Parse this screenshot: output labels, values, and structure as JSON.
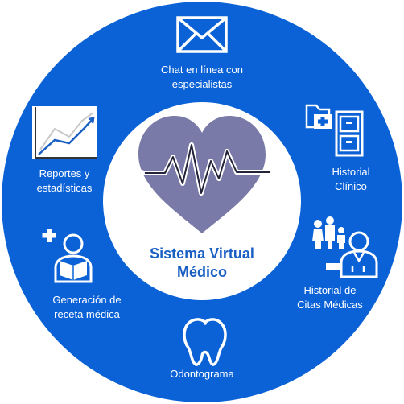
{
  "colors": {
    "ring": "#0b62d6",
    "center_bg": "#ffffff",
    "heart": "#7a7aa8",
    "title": "#1a5fc4",
    "label": "#ffffff"
  },
  "center": {
    "title_line1": "Sistema Virtual",
    "title_line2": "Médico",
    "icon": "heart-pulse-icon"
  },
  "modules": [
    {
      "id": "chat",
      "icon": "envelope-icon",
      "line1": "Chat en línea con",
      "line2": "especialistas"
    },
    {
      "id": "historial-clinico",
      "icon": "medical-files-icon",
      "line1": "Historial",
      "line2": "Clínico"
    },
    {
      "id": "historial-citas",
      "icon": "doctor-family-icon",
      "line1": "Historial de",
      "line2": "Citas Médicas"
    },
    {
      "id": "odontograma",
      "icon": "tooth-icon",
      "line1": "Odontograma",
      "line2": ""
    },
    {
      "id": "receta",
      "icon": "prescription-reader-icon",
      "line1": "Generación de",
      "line2": "receta médica"
    },
    {
      "id": "reportes",
      "icon": "line-chart-icon",
      "line1": "Reportes y",
      "line2": "estadísticas"
    }
  ]
}
